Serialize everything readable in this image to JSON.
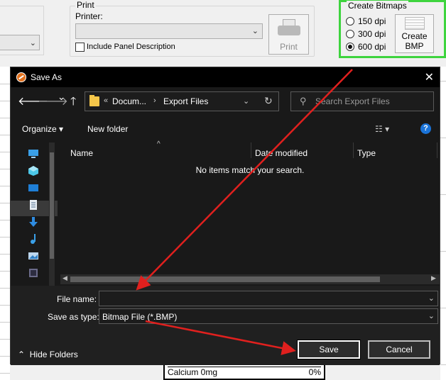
{
  "background": {
    "print_group": {
      "title": "Print",
      "printer_label": "Printer:",
      "printer_value": "",
      "include_label": "Include Panel Description",
      "print_button": "Print"
    },
    "bitmaps": {
      "title": "Create Bitmaps",
      "options": [
        {
          "label": "150 dpi",
          "checked": false
        },
        {
          "label": "300 dpi",
          "checked": false
        },
        {
          "label": "600 dpi",
          "checked": true
        }
      ],
      "button_line1": "Create",
      "button_line2": "BMP",
      "highlight_color": "#3ed43e"
    },
    "nutrition_row": {
      "label": "Calcium 0mg",
      "value": "0%"
    }
  },
  "dialog": {
    "title": "Save As",
    "close_glyph": "✕",
    "nav": {
      "back": "🡐",
      "forward": "🡒",
      "recent": "⌄",
      "up": "🡑"
    },
    "address": {
      "overflow": "«",
      "crumbs": [
        "Docum...",
        "Export Files"
      ],
      "separator": "›"
    },
    "search_placeholder": "Search Export Files",
    "toolbar": {
      "organize": "Organize ▾",
      "new_folder": "New folder"
    },
    "columns": [
      "Name",
      "Date modified",
      "Type"
    ],
    "empty_message": "No items match your search.",
    "footer": {
      "file_name_label": "File name:",
      "file_name_value": "",
      "save_type_label": "Save as type:",
      "save_type_value": "Bitmap File (*.BMP)",
      "hide_folders": "Hide Folders",
      "save_button": "Save",
      "cancel_button": "Cancel"
    },
    "nav_icons": [
      "computer-icon",
      "3d-objects-icon",
      "desktop-icon",
      "documents-icon",
      "downloads-icon",
      "music-icon",
      "pictures-icon",
      "videos-icon"
    ]
  },
  "colors": {
    "dialog_bg": "#191919",
    "annotation_arrow": "#e0201e",
    "accent_blue": "#1a73d8"
  }
}
